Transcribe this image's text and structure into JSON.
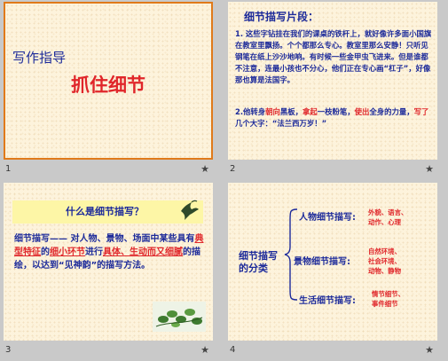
{
  "slides": [
    {
      "number": "1",
      "line1": "写作指导",
      "line2": "抓住细节"
    },
    {
      "number": "2",
      "title": "细节描写片段：",
      "para1": "1. 这些字钻挂在我们的课桌的铁杆上，就好像许多面小国旗在教室里飘扬。个个都那么专心。教室里那么安静！只听见钢笔在纸上沙沙地响。有时候一些金甲虫飞进来。但是谁都不注意，连最小孩也不分心，他们正在专心画“杠子”，好像那也算是法国字。",
      "para2_pre": "2.他转身",
      "para2_w1": "朝向",
      "para2_mid1": "黑板，",
      "para2_w2": "拿起",
      "para2_mid2": "一枝粉笔，",
      "para2_w3": "使出",
      "para2_mid3": "全身的力量，",
      "para2_w4": "写了",
      "para2_end": "几个大字：“法兰西万岁！”"
    },
    {
      "number": "3",
      "banner": "什么是细节描写？",
      "def_term": "细节描写",
      "def_a": "—— 对人物、景物、场面中某些具有",
      "hl1": "典型特征",
      "def_b": "的",
      "hl2": "细小环节",
      "def_c": "进行",
      "hl3": "具体、生动而又细腻",
      "def_d": "的描绘，以达到“见神韵”的描写方法。"
    },
    {
      "number": "4",
      "main": "细节描写的分类",
      "cat1": "人物细节描写:",
      "cat1_items": [
        "外貌、语言、",
        "动作、心理"
      ],
      "cat2": "景物细节描写:",
      "cat2_items": [
        "自然环境、",
        "社会环境、",
        "动物、静物"
      ],
      "cat3": "生活细节描写:",
      "cat3_items": [
        "情节细节、",
        "事件细节"
      ]
    }
  ],
  "star_icon": "★"
}
